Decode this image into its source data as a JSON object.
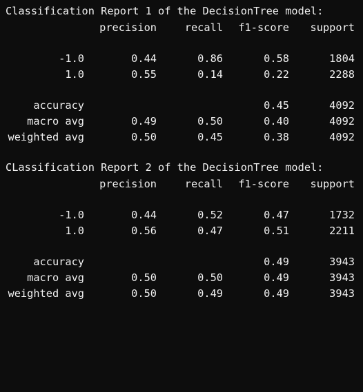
{
  "reports": [
    {
      "title": "Classification Report 1 of the DecisionTree model:",
      "headers": {
        "precision": "precision",
        "recall": "recall",
        "f1": "f1-score",
        "support": "support"
      },
      "rows": [
        {
          "label": "-1.0",
          "precision": "0.44",
          "recall": "0.86",
          "f1": "0.58",
          "support": "1804"
        },
        {
          "label": "1.0",
          "precision": "0.55",
          "recall": "0.14",
          "f1": "0.22",
          "support": "2288"
        }
      ],
      "accuracy": {
        "label": "accuracy",
        "f1": "0.45",
        "support": "4092"
      },
      "macro": {
        "label": "macro avg",
        "precision": "0.49",
        "recall": "0.50",
        "f1": "0.40",
        "support": "4092"
      },
      "weighted": {
        "label": "weighted avg",
        "precision": "0.50",
        "recall": "0.45",
        "f1": "0.38",
        "support": "4092"
      }
    },
    {
      "title": "CLassification Report 2 of the DecisionTree model:",
      "headers": {
        "precision": "precision",
        "recall": "recall",
        "f1": "f1-score",
        "support": "support"
      },
      "rows": [
        {
          "label": "-1.0",
          "precision": "0.44",
          "recall": "0.52",
          "f1": "0.47",
          "support": "1732"
        },
        {
          "label": "1.0",
          "precision": "0.56",
          "recall": "0.47",
          "f1": "0.51",
          "support": "2211"
        }
      ],
      "accuracy": {
        "label": "accuracy",
        "f1": "0.49",
        "support": "3943"
      },
      "macro": {
        "label": "macro avg",
        "precision": "0.50",
        "recall": "0.50",
        "f1": "0.49",
        "support": "3943"
      },
      "weighted": {
        "label": "weighted avg",
        "precision": "0.50",
        "recall": "0.49",
        "f1": "0.49",
        "support": "3943"
      }
    }
  ]
}
